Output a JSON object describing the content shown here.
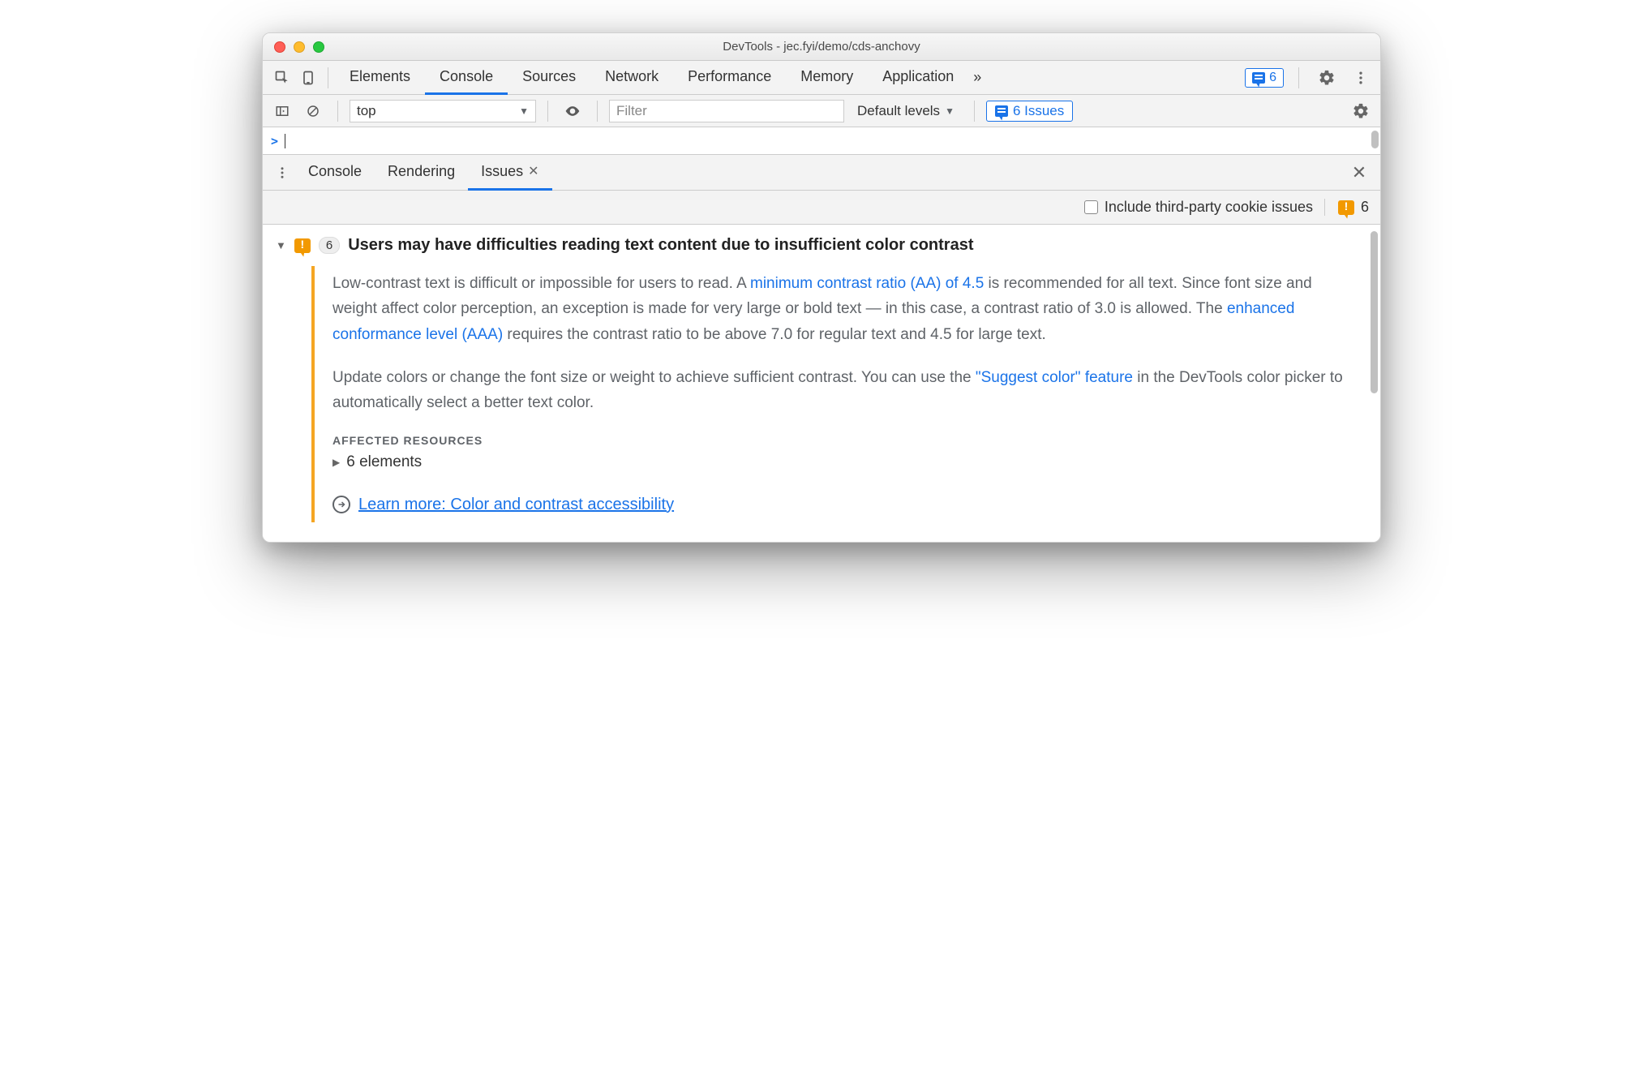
{
  "window": {
    "title": "DevTools - jec.fyi/demo/cds-anchovy"
  },
  "mainTabs": {
    "items": [
      "Elements",
      "Console",
      "Sources",
      "Network",
      "Performance",
      "Memory",
      "Application"
    ],
    "activeIndex": 1,
    "issuesBadgeCount": "6"
  },
  "consoleToolbar": {
    "context": "top",
    "filterPlaceholder": "Filter",
    "levels": "Default levels",
    "issuesLabel": "6 Issues"
  },
  "consolePrompt": ">",
  "drawer": {
    "tabs": [
      "Console",
      "Rendering",
      "Issues"
    ],
    "activeIndex": 2
  },
  "issuesFilter": {
    "includeThirdParty": "Include third-party cookie issues",
    "totalCount": "6"
  },
  "issue": {
    "count": "6",
    "title": "Users may have difficulties reading text content due to insufficient color contrast",
    "para1_a": "Low-contrast text is difficult or impossible for users to read. A ",
    "link1": "minimum contrast ratio (AA) of 4.5",
    "para1_b": " is recommended for all text. Since font size and weight affect color perception, an exception is made for very large or bold text — in this case, a contrast ratio of 3.0 is allowed. The ",
    "link2": "enhanced conformance level (AAA)",
    "para1_c": " requires the contrast ratio to be above 7.0 for regular text and 4.5 for large text.",
    "para2_a": "Update colors or change the font size or weight to achieve sufficient contrast. You can use the ",
    "link3": "\"Suggest color\" feature",
    "para2_b": " in the DevTools color picker to automatically select a better text color.",
    "affectedLabel": "AFFECTED RESOURCES",
    "affectedItem": "6 elements",
    "learnMore": "Learn more: Color and contrast accessibility"
  }
}
